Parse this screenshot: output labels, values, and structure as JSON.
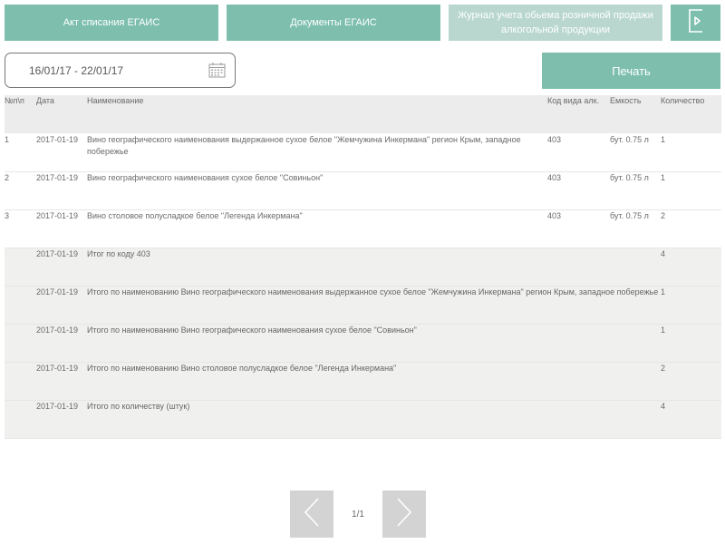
{
  "tabs": {
    "act": "Акт списания ЕГАИС",
    "docs": "Документы ЕГАИС",
    "journal": "Журнал учета обьема розничной продажи алкогольной продукции"
  },
  "icons": {
    "exit": "exit-icon",
    "calendar": "calendar-icon",
    "prev": "chevron-left-icon",
    "next": "chevron-right-icon"
  },
  "colors": {
    "accent": "#7dbfac",
    "accent_disabled": "#b9d7cf",
    "row_summary": "#f0f0ee",
    "pager": "#d3d3d3"
  },
  "filter": {
    "date_range": "16/01/17 - 22/01/17"
  },
  "print_label": "Печать",
  "table": {
    "headers": {
      "num": "№п\\п",
      "date": "Дата",
      "name": "Наименование",
      "code": "Код вида алк.",
      "capacity": "Емкость",
      "qty": "Количество"
    },
    "rows": [
      {
        "num": "1",
        "date": "2017-01-19",
        "name": "Вино географического наименования выдержанное сухое белое \"Жемчужина Инкермана\" регион Крым, западное побережье",
        "code": "403",
        "capacity": "бут. 0.75 л",
        "qty": "1"
      },
      {
        "num": "2",
        "date": "2017-01-19",
        "name": "Вино географического наименования сухое белое \"Совиньон\"",
        "code": "403",
        "capacity": "бут. 0.75 л",
        "qty": "1"
      },
      {
        "num": "3",
        "date": "2017-01-19",
        "name": "Вино столовое полусладкое белое \"Легенда Инкермана\"",
        "code": "403",
        "capacity": "бут. 0.75 л",
        "qty": "2"
      }
    ],
    "summaries": [
      {
        "date": "2017-01-19",
        "label": "Итог по коду 403",
        "qty": "4"
      },
      {
        "date": "2017-01-19",
        "label": "Итого по наименованию Вино географического наименования выдержанное сухое белое \"Жемчужина Инкермана\" регион Крым, западное побережье",
        "qty": "1"
      },
      {
        "date": "2017-01-19",
        "label": "Итого по наименованию Вино географического наименования сухое белое \"Совиньон\"",
        "qty": "1"
      },
      {
        "date": "2017-01-19",
        "label": "Итого по наименованию Вино столовое полусладкое белое \"Легенда Инкермана\"",
        "qty": "2"
      },
      {
        "date": "2017-01-19",
        "label": "Итого по количеству (штук)",
        "qty": "4"
      }
    ]
  },
  "pagination": {
    "current": "1/1"
  }
}
